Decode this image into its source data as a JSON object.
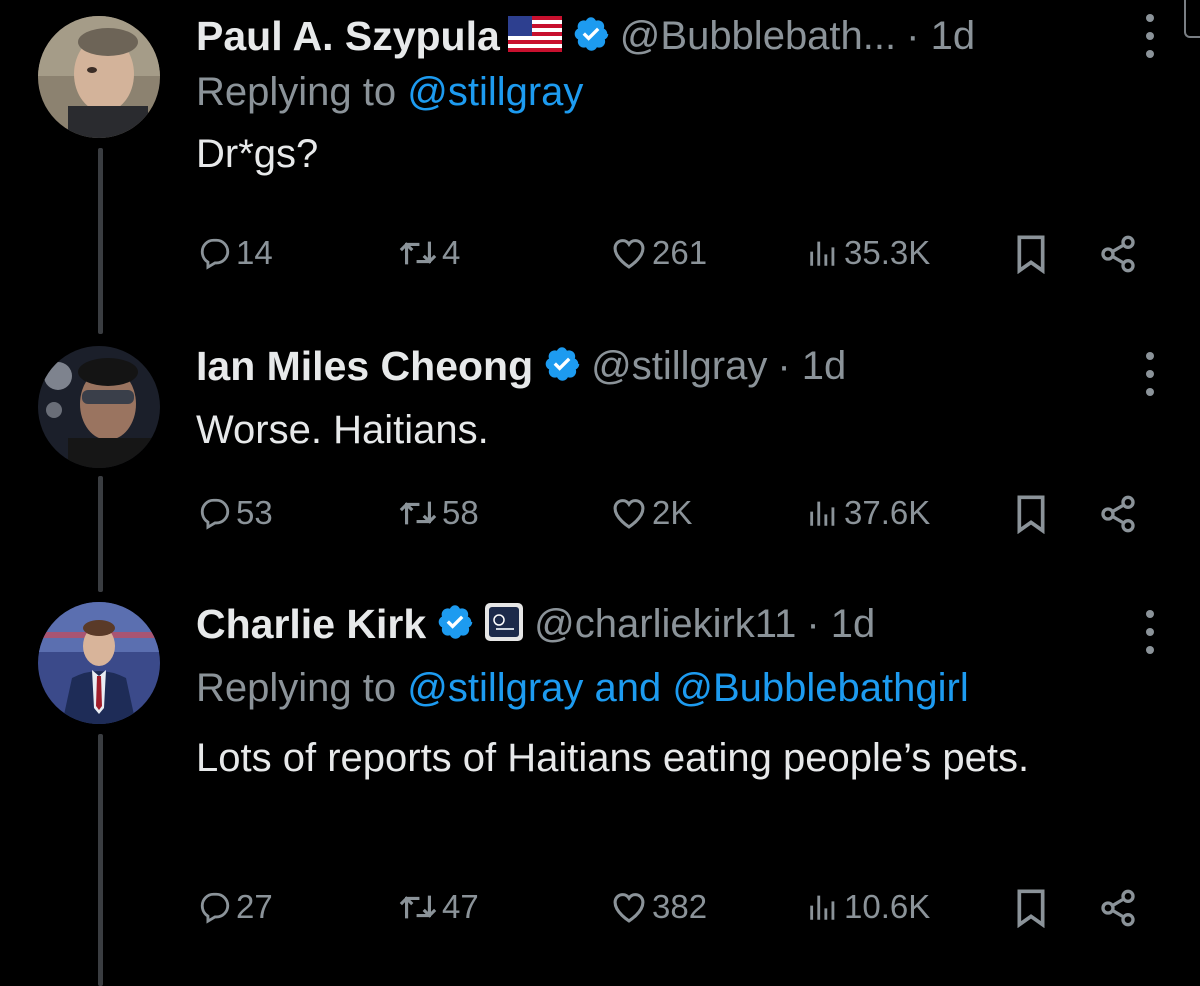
{
  "tweets": [
    {
      "name": "Paul A. Szypula",
      "handle": "@Bubblebath...",
      "time": "· 1d",
      "replying_prefix": "Replying to ",
      "replying_mentions": "@stillgray",
      "text": "Dr*gs?",
      "counts": {
        "replies": "14",
        "reposts": "4",
        "likes": "261",
        "views": "35.3K"
      },
      "has_flag": true
    },
    {
      "name": "Ian Miles Cheong",
      "handle": "@stillgray",
      "time": "· 1d",
      "text": "Worse. Haitians.",
      "counts": {
        "replies": "53",
        "reposts": "58",
        "likes": "2K",
        "views": "37.6K"
      }
    },
    {
      "name": "Charlie Kirk",
      "handle": "@charliekirk11",
      "time": "· 1d",
      "replying_prefix": "Replying to ",
      "replying_mentions": "@stillgray and @Bubblebathgirl",
      "text": "Lots of reports of Haitians eating people’s pets.",
      "counts": {
        "replies": "27",
        "reposts": "47",
        "likes": "382",
        "views": "10.6K"
      },
      "has_affiliate_badge": true
    }
  ],
  "icons": {
    "reply": "speech-bubble-icon",
    "repost": "repost-arrows-icon",
    "like": "heart-icon",
    "views": "bar-chart-icon",
    "bookmark": "bookmark-icon",
    "share": "share-icon",
    "verified": "verified-badge-icon",
    "more": "more-vertical-icon"
  },
  "colors": {
    "background": "#000000",
    "text": "#e7e9ea",
    "muted": "#8b9399",
    "link": "#1d9bf0",
    "verified": "#1d9bf0",
    "thread_line": "#3a3d41"
  }
}
